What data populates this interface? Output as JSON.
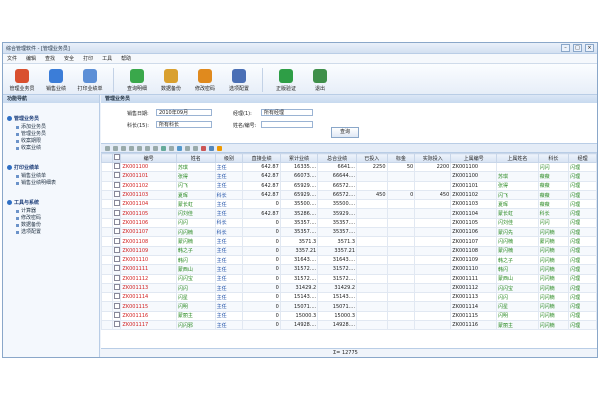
{
  "window": {
    "title": "综合管理软件 - [管理业务员]"
  },
  "menu": [
    "文件",
    "编辑",
    "查找",
    "安全",
    "打印",
    "工具",
    "帮助"
  ],
  "toolbar": [
    {
      "label": "管理业务员",
      "color": "#d9502f"
    },
    {
      "label": "销售业绩",
      "color": "#3b7dd8"
    },
    {
      "label": "打印业绩单",
      "color": "#5c8fd6"
    },
    {
      "label": "查询明细",
      "color": "#3aa84b"
    },
    {
      "label": "数据备份",
      "color": "#d9a02f"
    },
    {
      "label": "修改密码",
      "color": "#e08a1e"
    },
    {
      "label": "选项配置",
      "color": "#4a6fb5"
    },
    {
      "label": "正版验证",
      "color": "#2e9e46"
    },
    {
      "label": "退出",
      "color": "#3f8f4a"
    }
  ],
  "sidebar": {
    "header": "功能导航",
    "sections": [
      {
        "title": "管理业务员",
        "items": [
          "添加业务员",
          "管理业务员",
          "收案期限",
          "收案业绩"
        ]
      },
      {
        "title": "打印业绩单",
        "items": [
          "销售业绩单",
          "销售业绩明细表"
        ]
      },
      {
        "title": "工具与系统",
        "items": [
          "计算器",
          "修改密码",
          "数据备份",
          "选项配置"
        ]
      }
    ]
  },
  "main": {
    "tab": "管理业务员",
    "filters": {
      "date_label": "销售日期:",
      "date_value": "2010年09月",
      "manager_label": "经理(1):",
      "manager_value": "所有经理",
      "dept_label": "科长(15):",
      "dept_value": "所有科长",
      "name_label": "姓名/编号:",
      "name_value": "",
      "query": "查询"
    },
    "columns": [
      "编号",
      "姓名",
      "级别",
      "直接业绩",
      "累计业绩",
      "总合业绩",
      "已投入",
      "标金",
      "实际投入",
      "上属编号",
      "上属姓名",
      "科长",
      "经理"
    ],
    "rows": [
      [
        "ZK001100",
        "苏琪",
        "主任",
        "642.87",
        "16335....",
        "6641...",
        "2250",
        "50",
        "2200",
        "ZK001100",
        "",
        "闪闪",
        "闪理"
      ],
      [
        "ZK001101",
        "张得",
        "主任",
        "642.87",
        "66073....",
        "66644....",
        "",
        "",
        "",
        "ZK001100",
        "苏琪",
        "薇薇",
        "闪理"
      ],
      [
        "ZK001102",
        "闪飞",
        "主任",
        "642.87",
        "65929....",
        "66572....",
        "",
        "",
        "",
        "ZK001101",
        "张得",
        "薇薇",
        "闪理"
      ],
      [
        "ZK001103",
        "夏晖",
        "科长",
        "642.87",
        "65929....",
        "66572....",
        "450",
        "0",
        "450",
        "ZK001102",
        "闪飞",
        "薇薇",
        "闪理"
      ],
      [
        "ZK001104",
        "蒙长虹",
        "主任",
        "0",
        "35500....",
        "35500....",
        "",
        "",
        "",
        "ZK001103",
        "夏晖",
        "薇薇",
        "闪理"
      ],
      [
        "ZK001105",
        "闪刘佳",
        "主任",
        "642.87",
        "35286....",
        "35929....",
        "",
        "",
        "",
        "ZK001104",
        "蒙长虹",
        "科长",
        "闪理"
      ],
      [
        "ZK001106",
        "闪闪",
        "科长",
        "0",
        "35357....",
        "35357....",
        "",
        "",
        "",
        "ZK001105",
        "闪刘佳",
        "闪闪",
        "闪理"
      ],
      [
        "ZK001107",
        "闪闪楠",
        "科长",
        "0",
        "35357....",
        "35357....",
        "",
        "",
        "",
        "ZK001106",
        "蒙闪先",
        "闪闪楠",
        "闪理"
      ],
      [
        "ZK001108",
        "蒙闪楠",
        "主任",
        "0",
        "3571.3",
        "3571.3",
        "",
        "",
        "",
        "ZK001107",
        "闪闪楠",
        "蒙闪楠",
        "闪理"
      ],
      [
        "ZK001109",
        "韩之子",
        "主任",
        "0",
        "3357.21",
        "3357.21",
        "",
        "",
        "",
        "ZK001108",
        "蒙闪楠",
        "闪闪楠",
        "闪理"
      ],
      [
        "ZK001110",
        "韩闪",
        "主任",
        "0",
        "31643....",
        "31643....",
        "",
        "",
        "",
        "ZK001109",
        "韩之子",
        "闪闪楠",
        "闪理"
      ],
      [
        "ZK001111",
        "蒙西山",
        "主任",
        "0",
        "31572....",
        "31572....",
        "",
        "",
        "",
        "ZK001110",
        "韩闪",
        "闪闪楠",
        "闪理"
      ],
      [
        "ZK001112",
        "闪闪宝",
        "主任",
        "0",
        "31572....",
        "31572....",
        "",
        "",
        "",
        "ZK001111",
        "蒙西山",
        "闪闪楠",
        "闪理"
      ],
      [
        "ZK001113",
        "闪闪",
        "主任",
        "0",
        "31429.2",
        "31429.2",
        "",
        "",
        "",
        "ZK001112",
        "闪闪宝",
        "闪闪楠",
        "闪理"
      ],
      [
        "ZK001114",
        "闪星",
        "主任",
        "0",
        "15143....",
        "15143....",
        "",
        "",
        "",
        "ZK001113",
        "闪闪",
        "闪闪楠",
        "闪理"
      ],
      [
        "ZK001115",
        "闪明",
        "主任",
        "0",
        "15071....",
        "15071....",
        "",
        "",
        "",
        "ZK001114",
        "闪星",
        "闪闪楠",
        "闪理"
      ],
      [
        "ZK001116",
        "蒙丽主",
        "主任",
        "0",
        "15000.3",
        "15000.3",
        "",
        "",
        "",
        "ZK001115",
        "闪明",
        "闪闪楠",
        "闪理"
      ],
      [
        "ZK001117",
        "闪闪邪",
        "主任",
        "0",
        "14928....",
        "14928....",
        "",
        "",
        "",
        "ZK001116",
        "蒙丽主",
        "闪闪楠",
        "闪理"
      ]
    ],
    "footer_total": "Σ= 12775"
  },
  "watermark": "shswpt.com"
}
